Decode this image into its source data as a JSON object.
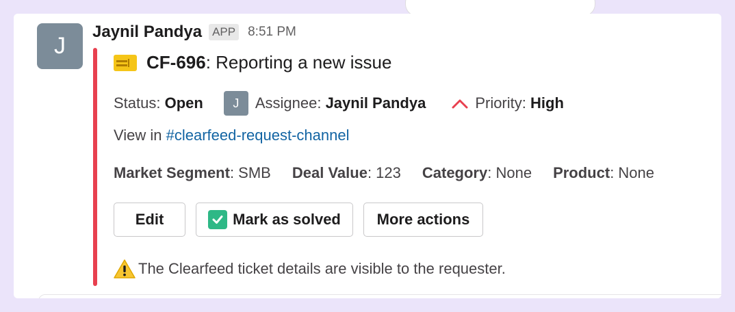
{
  "message": {
    "avatar_letter": "J",
    "sender_name": "Jaynil Pandya",
    "app_badge": "APP",
    "time": "8:51 PM"
  },
  "ticket": {
    "icon": "ticket-icon",
    "key": "CF-696",
    "separator": ": ",
    "title": "Reporting a new issue",
    "status_label": "Status: ",
    "status_value": "Open",
    "assignee_avatar_letter": "J",
    "assignee_label": "Assignee: ",
    "assignee_value": "Jaynil Pandya",
    "priority_icon": "chevron-up-icon",
    "priority_label": "Priority: ",
    "priority_value": "High",
    "view_prefix": "View in ",
    "channel_link": "#clearfeed-request-channel",
    "fields": [
      {
        "label": "Market Segment",
        "value": ": SMB"
      },
      {
        "label": "Deal Value",
        "value": ": 123"
      },
      {
        "label": "Category",
        "value": ": None"
      },
      {
        "label": "Product",
        "value": ": None"
      }
    ],
    "accent_color": "#e8404f"
  },
  "actions": {
    "edit_label": "Edit",
    "mark_solved_label": "Mark as solved",
    "more_actions_label": "More actions"
  },
  "notice": {
    "icon": "warning-icon",
    "text": "The Clearfeed ticket details are visible to the requester."
  }
}
